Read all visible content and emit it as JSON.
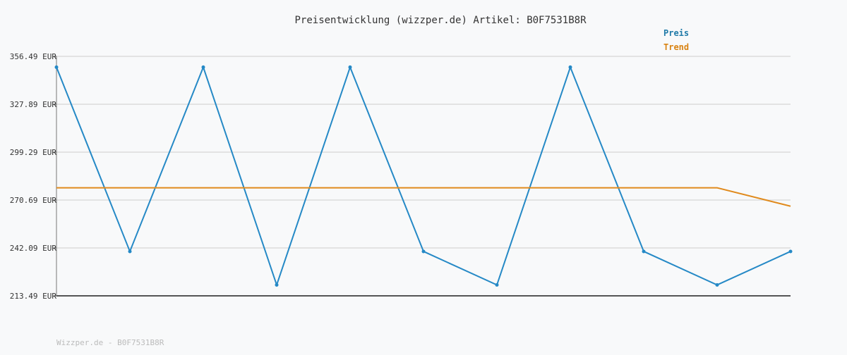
{
  "chart_data": {
    "type": "line",
    "title": "Preisentwicklung (wizzper.de) Artikel: B0F7531B8R",
    "xlabel": "",
    "ylabel": "",
    "ylim": [
      213.49,
      356.49
    ],
    "y_ticks": [
      356.49,
      327.89,
      299.29,
      270.69,
      242.09,
      213.49
    ],
    "y_tick_labels": [
      "356.49 EUR",
      "327.89 EUR",
      "299.29 EUR",
      "270.69 EUR",
      "242.09 EUR",
      "213.49 EUR"
    ],
    "x": [
      0,
      1,
      2,
      3,
      4,
      5,
      6,
      7,
      8,
      9,
      10
    ],
    "series": [
      {
        "name": "Preis",
        "color": "#2589c6",
        "markers": true,
        "values": [
          350.0,
          240.0,
          350.0,
          220.0,
          350.0,
          240.0,
          220.0,
          350.0,
          240.0,
          220.0,
          240.0
        ]
      },
      {
        "name": "Trend",
        "color": "#e08a1c",
        "markers": false,
        "values": [
          278.0,
          278.0,
          278.0,
          278.0,
          278.0,
          278.0,
          278.0,
          278.0,
          278.0,
          278.0,
          267.0
        ]
      }
    ],
    "grid": true,
    "legend_position": "top-right"
  },
  "legend": {
    "price_label": "Preis",
    "trend_label": "Trend"
  },
  "footer": {
    "text": "Wizzper.de - B0F7531B8R"
  }
}
